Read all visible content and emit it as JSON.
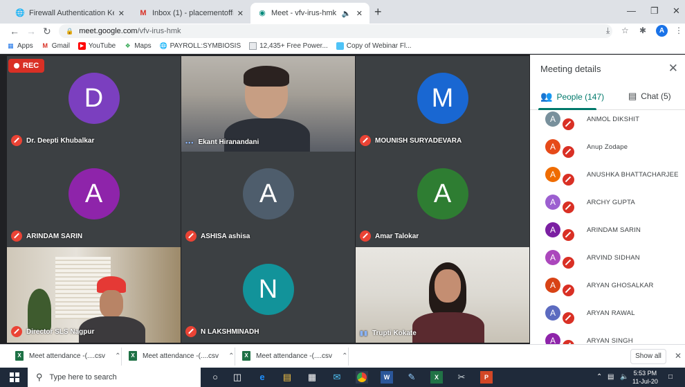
{
  "tabs": [
    {
      "title": "Firewall Authentication Keepalive",
      "icon": "globe-icon"
    },
    {
      "title": "Inbox (1) - placementofficer@sis",
      "icon": "gmail-icon"
    },
    {
      "title": "Meet - vfv-irus-hmk",
      "icon": "meet-icon",
      "active": true
    }
  ],
  "address": {
    "host": "meet.google.com",
    "path": "/vfv-irus-hmk",
    "profile_initial": "A"
  },
  "bookmarks": [
    "Apps",
    "Gmail",
    "YouTube",
    "Maps",
    "PAYROLL:SYMBIOSIS",
    "12,435+ Free Power...",
    "Copy of Webinar Fl..."
  ],
  "rec_label": "REC",
  "tiles": [
    {
      "name": "Dr. Deepti Khubalkar",
      "initial": "D",
      "color": "#7b3fbf",
      "muted": true
    },
    {
      "name": "Ekant Hiranandani",
      "video": true,
      "speaking": true,
      "muted": false
    },
    {
      "name": "MOUNISH SURYADEVARA",
      "initial": "M",
      "color": "#1967d2",
      "muted": true
    },
    {
      "name": "ARINDAM SARIN",
      "initial": "A",
      "color": "#8e24aa",
      "muted": true
    },
    {
      "name": "ASHISA ashisa",
      "initial": "A",
      "color": "#4e5d6c",
      "muted": true
    },
    {
      "name": "Amar Talokar",
      "initial": "A",
      "color": "#2e7d32",
      "muted": true
    },
    {
      "name": "Director SLS Nagpur",
      "video": true,
      "muted": true
    },
    {
      "name": "N LAKSHMINADH",
      "initial": "N",
      "color": "#12939a",
      "muted": true
    },
    {
      "name": "Trupti Kokate",
      "video": true,
      "speaking": true,
      "muted": false
    }
  ],
  "panel": {
    "title": "Meeting details",
    "people_tab": "People (147)",
    "chat_tab": "Chat (5)",
    "people": [
      {
        "name": "ANMOL DIKSHIT",
        "initial": "A",
        "color": "#78909c"
      },
      {
        "name": "Anup Zodape",
        "initial": "A",
        "color": "#e64a19"
      },
      {
        "name": "ANUSHKA BHATTACHARJEE",
        "initial": "A",
        "color": "#ef6c00"
      },
      {
        "name": "ARCHY GUPTA",
        "initial": "A",
        "color": "#9c5fd0"
      },
      {
        "name": "ARINDAM SARIN",
        "initial": "A",
        "color": "#7b1fa2"
      },
      {
        "name": "ARVIND SIDHAN",
        "initial": "A",
        "color": "#ab47bc"
      },
      {
        "name": "ARYAN GHOSALKAR",
        "initial": "A",
        "color": "#d84315"
      },
      {
        "name": "ARYAN RAWAL",
        "initial": "A",
        "color": "#5c6bc0"
      },
      {
        "name": "ARYAN SINGH",
        "initial": "A",
        "color": "#8e24aa"
      }
    ]
  },
  "downloads": [
    "Meet attendance -(....csv",
    "Meet attendance -(....csv",
    "Meet attendance -(....csv"
  ],
  "show_all": "Show all",
  "taskbar": {
    "search_placeholder": "Type here to search",
    "time": "5:53 PM",
    "date": "11-Jul-20"
  }
}
